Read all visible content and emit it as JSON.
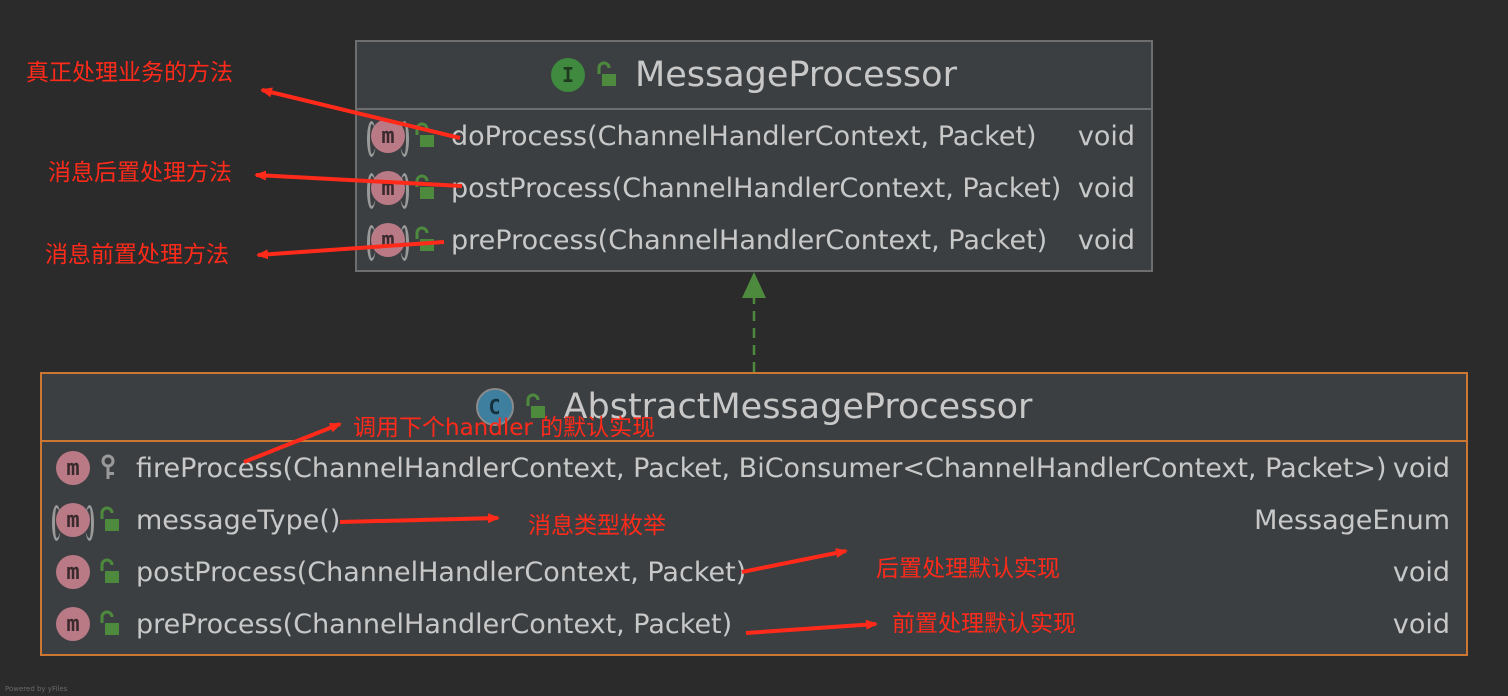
{
  "interface_box": {
    "kind_letter": "I",
    "title": "MessageProcessor",
    "methods": [
      {
        "signature": "doProcess(ChannelHandlerContext, Packet)",
        "return_type": "void",
        "icon_letter": "m"
      },
      {
        "signature": "postProcess(ChannelHandlerContext, Packet)",
        "return_type": "void",
        "icon_letter": "m"
      },
      {
        "signature": "preProcess(ChannelHandlerContext, Packet)",
        "return_type": "void",
        "icon_letter": "m"
      }
    ]
  },
  "class_box": {
    "kind_letter": "C",
    "title": "AbstractMessageProcessor",
    "methods": [
      {
        "signature": "fireProcess(ChannelHandlerContext, Packet, BiConsumer<ChannelHandlerContext, Packet>)",
        "return_type": "void",
        "icon_letter": "m"
      },
      {
        "signature": "messageType()",
        "return_type": "MessageEnum",
        "icon_letter": "m"
      },
      {
        "signature": "postProcess(ChannelHandlerContext, Packet)",
        "return_type": "void",
        "icon_letter": "m"
      },
      {
        "signature": "preProcess(ChannelHandlerContext, Packet)",
        "return_type": "void",
        "icon_letter": "m"
      }
    ]
  },
  "annotations": {
    "do_process": "真正处理业务的方法",
    "post_process": "消息后置处理方法",
    "pre_process": "消息前置处理方法",
    "fire_process": "调用下个handler 的默认实现",
    "message_type": "消息类型枚举",
    "post_default": "后置处理默认实现",
    "pre_default": "前置处理默认实现"
  },
  "footer": "Powered by yFiles",
  "colors": {
    "background": "#2b2b2b",
    "box_fill": "#3c3f41",
    "interface_border": "#6e6e6e",
    "class_border": "#cc7832",
    "annotation": "#ff2a1a",
    "arrow_green": "#4e8a3e"
  }
}
